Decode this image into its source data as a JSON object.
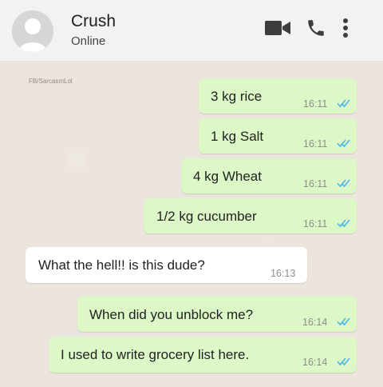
{
  "header": {
    "contact_name": "Crush",
    "status": "Online",
    "icons": [
      "avatar-placeholder",
      "video-call-icon",
      "phone-icon",
      "more-vert-icon"
    ]
  },
  "watermark": "FB/SarcasmLol",
  "colors": {
    "outgoing_bubble": "#dcf8c6",
    "incoming_bubble": "#ffffff",
    "read_ticks": "#4fb6ec",
    "header_bg": "#f4f1f1"
  },
  "messages": [
    {
      "direction": "outgoing",
      "text": "3 kg rice",
      "time": "16:11",
      "read": true
    },
    {
      "direction": "outgoing",
      "text": "1 kg Salt",
      "time": "16:11",
      "read": true
    },
    {
      "direction": "outgoing",
      "text": "4 kg Wheat",
      "time": "16:11",
      "read": true
    },
    {
      "direction": "outgoing",
      "text": "1/2 kg cucumber",
      "time": "16:11",
      "read": true
    },
    {
      "direction": "incoming",
      "text": "What the hell!! is this dude?",
      "time": "16:13"
    },
    {
      "direction": "outgoing",
      "text": "When did you unblock me?",
      "time": "16:14",
      "read": true
    },
    {
      "direction": "outgoing",
      "text": "I used to write grocery list here.",
      "time": "16:14",
      "read": true
    }
  ]
}
